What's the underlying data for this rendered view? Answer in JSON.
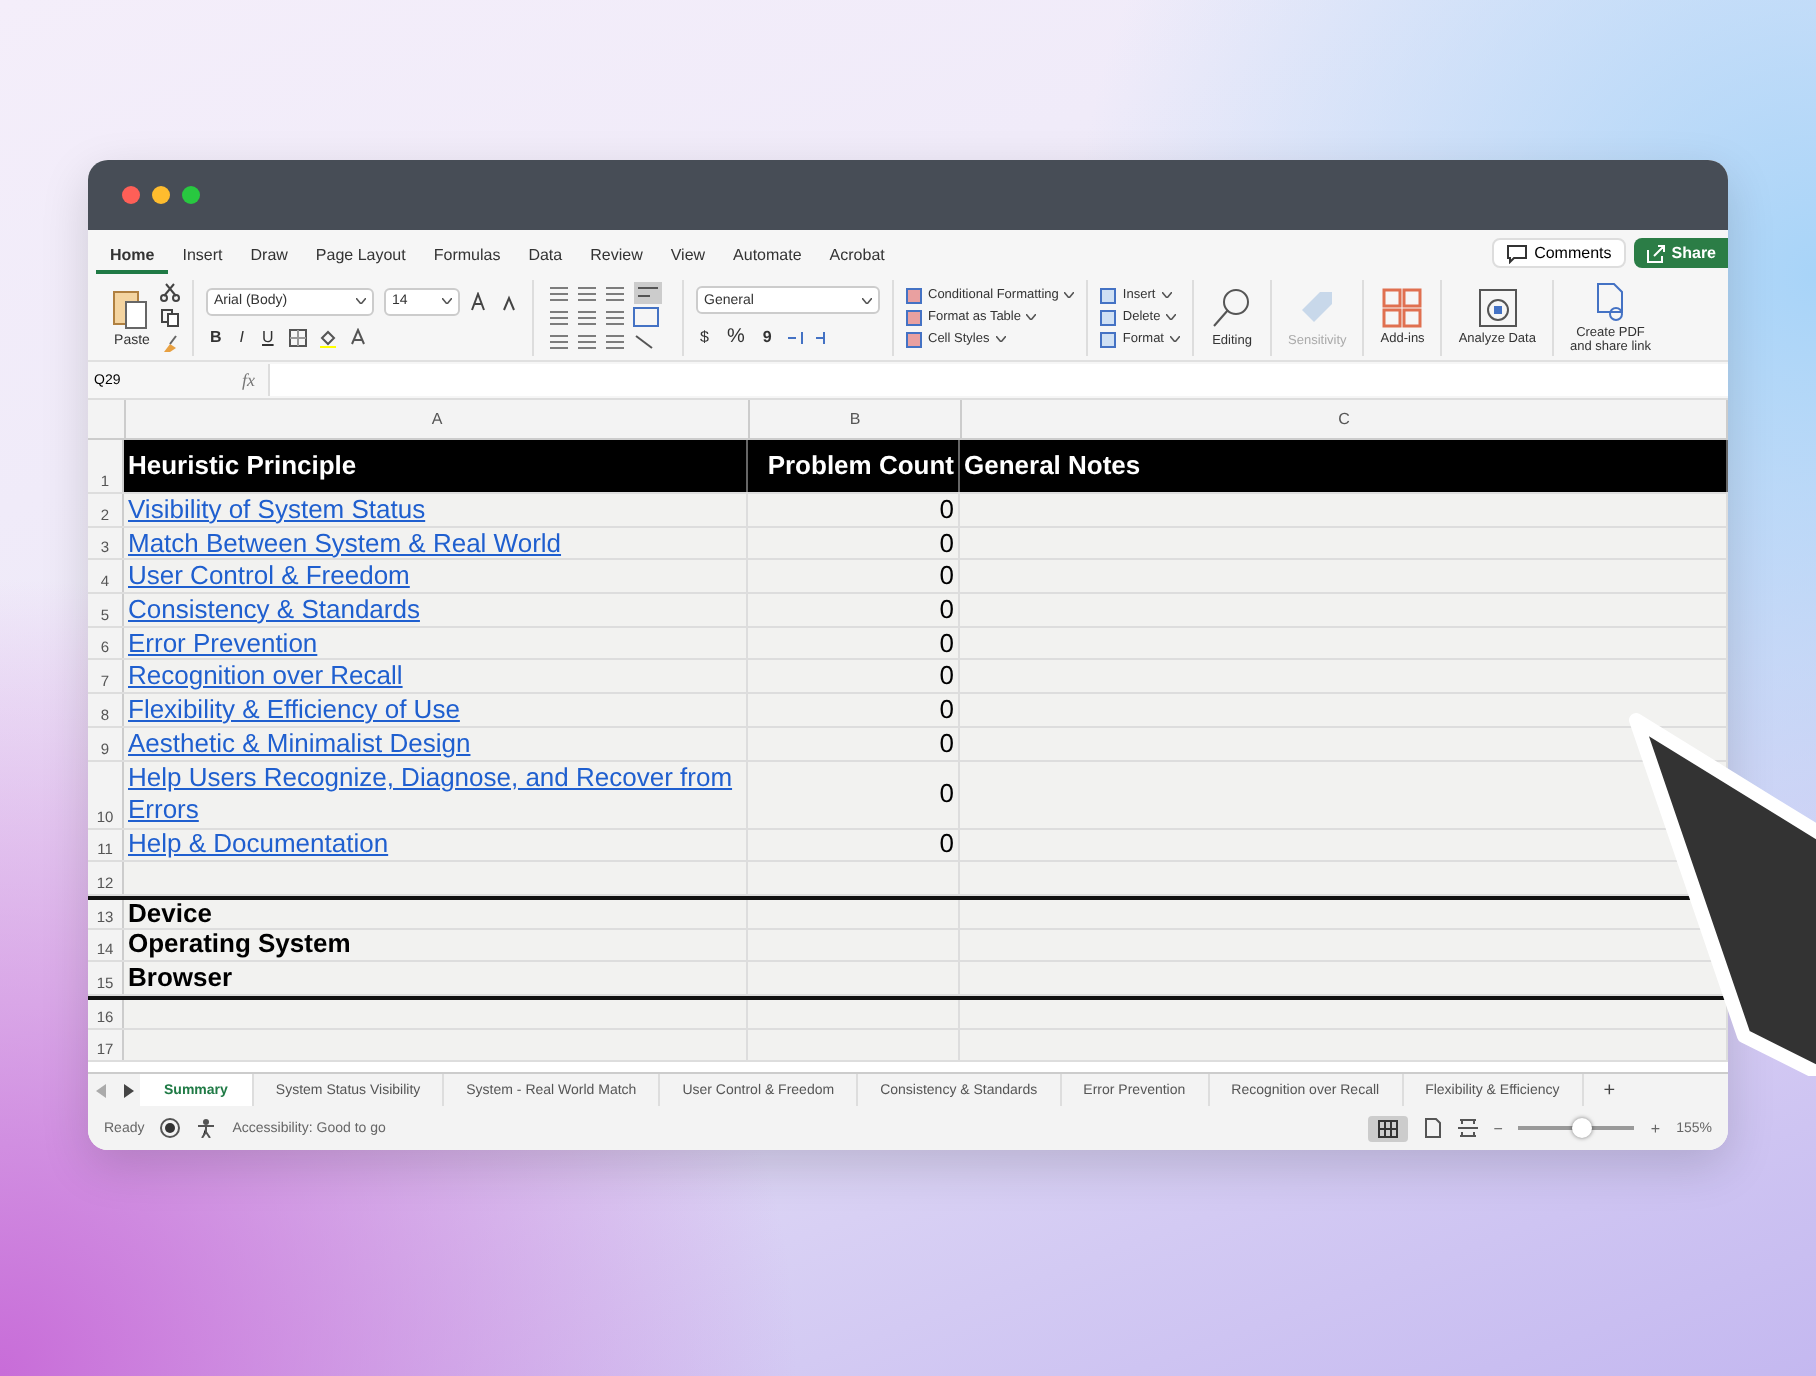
{
  "ribbon": {
    "tabs": [
      {
        "label": "Home",
        "selected": true
      },
      {
        "label": "Insert",
        "selected": false
      },
      {
        "label": "Draw",
        "selected": false
      },
      {
        "label": "Page Layout",
        "selected": false
      },
      {
        "label": "Formulas",
        "selected": false
      },
      {
        "label": "Data",
        "selected": false
      },
      {
        "label": "Review",
        "selected": false
      },
      {
        "label": "View",
        "selected": false
      },
      {
        "label": "Automate",
        "selected": false
      },
      {
        "label": "Acrobat",
        "selected": false
      }
    ],
    "comments": "Comments",
    "share": "Share",
    "paste": "Paste",
    "font_name": "Arial (Body)",
    "font_size": "14",
    "bold": "B",
    "italic": "I",
    "underline": "U",
    "number_format": "General",
    "currency": "$",
    "percent": "%",
    "comma": "9",
    "styles": [
      "Conditional Formatting",
      "Format as Table",
      "Cell Styles"
    ],
    "cells": [
      "Insert",
      "Delete",
      "Format"
    ],
    "editing": "Editing",
    "sensitivity": "Sensitivity",
    "addins": "Add-ins",
    "analyze": "Analyze Data",
    "create_pdf": [
      "Create PDF",
      "and share link"
    ]
  },
  "formula_bar": {
    "name_box": "Q29",
    "fx": "fx"
  },
  "sheet": {
    "columns": [
      "A",
      "B",
      "C"
    ],
    "rows": [
      {
        "number": "1",
        "kind": "header",
        "a": "Heuristic Principle",
        "b": "Problem Count",
        "c": "General Notes"
      },
      {
        "number": "2",
        "kind": "link",
        "a": "Visibility of System Status",
        "b": "0"
      },
      {
        "number": "3",
        "kind": "link",
        "a": "Match Between System & Real World",
        "b": "0"
      },
      {
        "number": "4",
        "kind": "link",
        "a": "User Control & Freedom",
        "b": "0"
      },
      {
        "number": "5",
        "kind": "link",
        "a": "Consistency & Standards",
        "b": "0"
      },
      {
        "number": "6",
        "kind": "link",
        "a": "Error Prevention",
        "b": "0"
      },
      {
        "number": "7",
        "kind": "link",
        "a": "Recognition over Recall",
        "b": "0"
      },
      {
        "number": "8",
        "kind": "link",
        "a": "Flexibility & Efficiency of Use",
        "b": "0"
      },
      {
        "number": "9",
        "kind": "link",
        "a": "Aesthetic & Minimalist Design",
        "b": "0"
      },
      {
        "number": "10",
        "kind": "link",
        "a": "Help Users Recognize, Diagnose, and Recover from Errors",
        "b": "0"
      },
      {
        "number": "11",
        "kind": "link",
        "a": "Help & Documentation",
        "b": "0"
      },
      {
        "number": "12",
        "kind": "empty"
      },
      {
        "number": "13",
        "kind": "label",
        "border_top": true,
        "a": "Device"
      },
      {
        "number": "14",
        "kind": "label",
        "a": "Operating System"
      },
      {
        "number": "15",
        "kind": "label",
        "a": "Browser"
      },
      {
        "number": "16",
        "kind": "empty",
        "border_top": true
      },
      {
        "number": "17",
        "kind": "empty"
      }
    ]
  },
  "sheet_tabs": [
    {
      "label": "Summary",
      "selected": true
    },
    {
      "label": "System Status Visibility",
      "selected": false
    },
    {
      "label": "System - Real World Match",
      "selected": false
    },
    {
      "label": "User Control & Freedom",
      "selected": false
    },
    {
      "label": "Consistency & Standards",
      "selected": false
    },
    {
      "label": "Error Prevention",
      "selected": false
    },
    {
      "label": "Recognition over Recall",
      "selected": false
    },
    {
      "label": "Flexibility & Efficiency",
      "selected": false
    }
  ],
  "add_sheet": "+",
  "status_bar": {
    "ready": "Ready",
    "accessibility": "Accessibility: Good to go",
    "zoom_out": "−",
    "zoom_in": "+",
    "zoom": {
      "level": 0.55
    },
    "zoom_text": "155%"
  }
}
